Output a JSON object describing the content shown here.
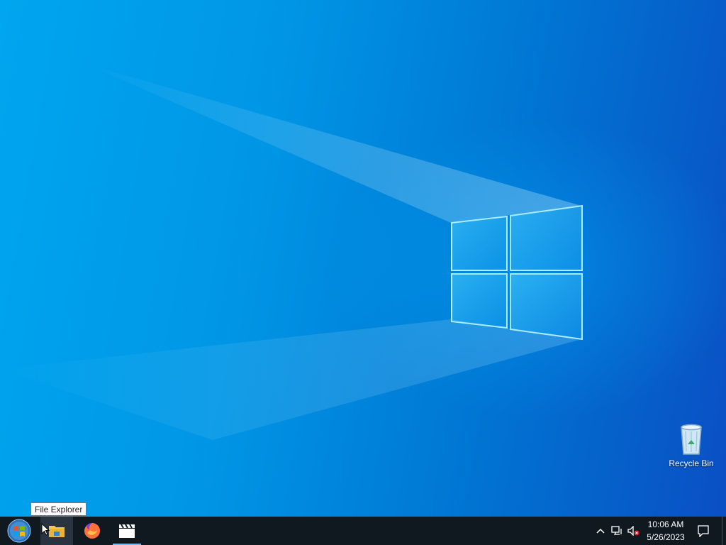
{
  "desktop": {
    "icons": [
      {
        "label": "Recycle Bin",
        "icon": "recycle-bin-icon"
      }
    ]
  },
  "tooltip": {
    "text": "File Explorer"
  },
  "taskbar": {
    "start": {
      "icon": "windows-start-orb-icon"
    },
    "pinned": [
      {
        "name": "File Explorer",
        "icon": "folder-icon",
        "state": "hovered"
      },
      {
        "name": "Firefox",
        "icon": "firefox-icon"
      },
      {
        "name": "Media",
        "icon": "clapperboard-icon",
        "state": "running"
      }
    ],
    "tray": {
      "icons": [
        "chevron-up-icon",
        "network-icon",
        "volume-muted-icon"
      ],
      "time": "10:06 AM",
      "date": "5/26/2023",
      "notification_icon": "action-center-icon"
    }
  },
  "colors": {
    "taskbar_bg": "#101820",
    "desktop_light": "#00a6ef",
    "desktop_dark": "#0a4fc4"
  }
}
